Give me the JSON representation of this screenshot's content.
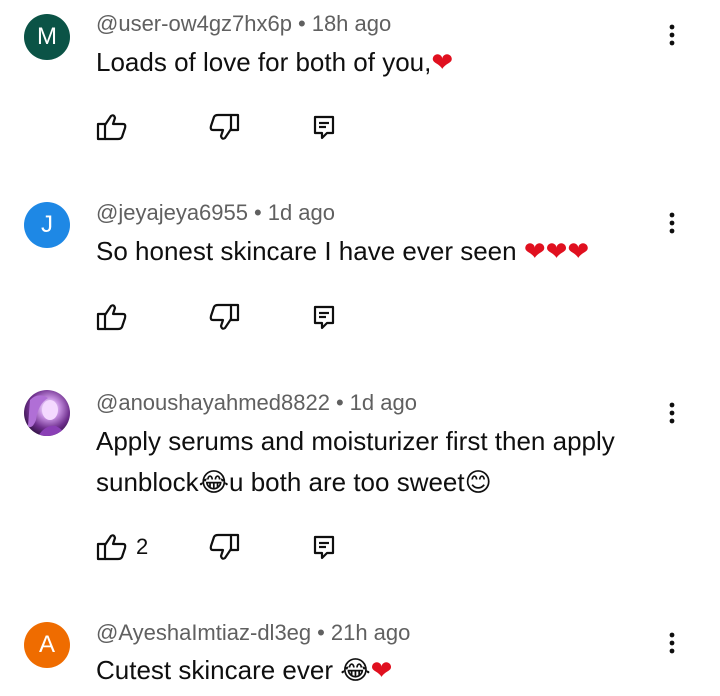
{
  "icons": {
    "like": "thumbs-up-icon",
    "dislike": "thumbs-down-icon",
    "reply": "reply-icon",
    "menu": "more-vertical-icon"
  },
  "colors": {
    "meta_text": "#606060",
    "body_text": "#0f0f0f",
    "heart": "#e0101f"
  },
  "comments": [
    {
      "avatar": {
        "letter": "M",
        "bg": "#0b5346"
      },
      "user": "@user-ow4gz7hx6p",
      "separator": "•",
      "time": "18h ago",
      "text": "Loads of love for both of you,",
      "emoji": [
        "❤"
      ],
      "likes": ""
    },
    {
      "avatar": {
        "letter": "J",
        "bg": "#1e88e5"
      },
      "user": "@jeyajeya6955",
      "separator": "•",
      "time": "1d ago",
      "text": "So honest skincare I have ever seen ",
      "emoji": [
        "❤",
        "❤",
        "❤"
      ],
      "likes": ""
    },
    {
      "avatar": {
        "letter": "",
        "bg": "#6d2e8c"
      },
      "user": "@anoushayahmed8822",
      "separator": "•",
      "time": "1d ago",
      "text_line1": "Apply serums and moisturizer first then apply",
      "text_line2a": "sunblock",
      "emoji_a": "😂",
      "text_line2b": "u both are too sweet",
      "emoji_b": "😊",
      "likes": "2"
    },
    {
      "avatar": {
        "letter": "A",
        "bg": "#ef6c00"
      },
      "user": "@AyeshaImtiaz-dl3eg",
      "separator": "•",
      "time": "21h ago",
      "text": "Cutest skincare ever ",
      "emoji": [
        "😂",
        "❤"
      ],
      "likes": ""
    }
  ]
}
